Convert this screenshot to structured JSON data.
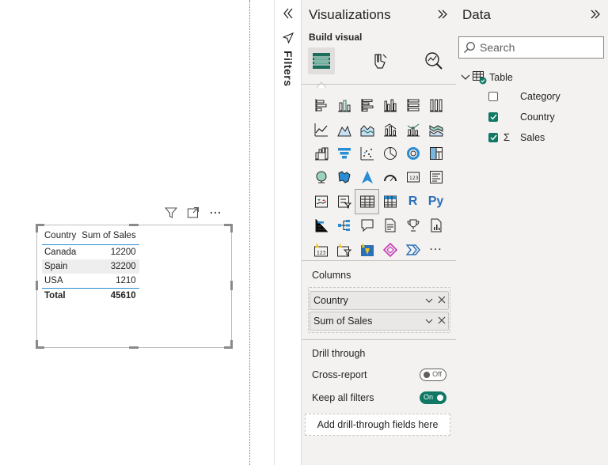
{
  "visual": {
    "headers": {
      "country": "Country",
      "sales": "Sum of Sales"
    },
    "rows": [
      {
        "country": "Canada",
        "sales": "12200"
      },
      {
        "country": "Spain",
        "sales": "32200"
      },
      {
        "country": "USA",
        "sales": "1210"
      }
    ],
    "total": {
      "label": "Total",
      "sales": "45610"
    }
  },
  "filters": {
    "title": "Filters"
  },
  "viz": {
    "title": "Visualizations",
    "build_visual": "Build visual",
    "columns_label": "Columns",
    "fields": [
      "Country",
      "Sum of Sales"
    ],
    "drill_through": "Drill through",
    "cross_report": {
      "label": "Cross-report",
      "state": "Off"
    },
    "keep_filters": {
      "label": "Keep all filters",
      "state": "On"
    },
    "drill_placeholder": "Add drill-through fields here",
    "r_label": "R",
    "py_label": "Py",
    "more": "···"
  },
  "data": {
    "title": "Data",
    "search_placeholder": "Search",
    "table": "Table",
    "fields": [
      {
        "name": "Category",
        "checked": false
      },
      {
        "name": "Country",
        "checked": true
      },
      {
        "name": "Sales",
        "checked": true
      }
    ]
  }
}
